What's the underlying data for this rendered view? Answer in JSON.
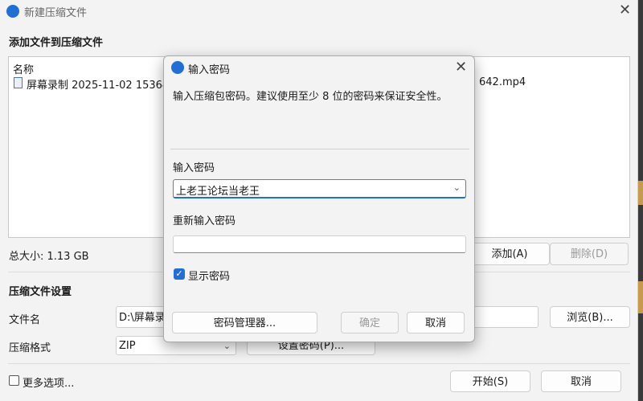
{
  "background": {
    "accent": "#c79b4e"
  },
  "window": {
    "title": "新建压缩文件",
    "section_add": "添加文件到压缩文件",
    "file_list": {
      "column_name": "名称",
      "items": [
        {
          "name_left": "屏幕录制 2025-11-02 153642",
          "name_right": "642.mp4"
        }
      ]
    },
    "total_size": "总大小: 1.13 GB",
    "add_button": "添加(A)",
    "delete_button": "删除(D)",
    "settings_title": "压缩文件设置",
    "filename_label": "文件名",
    "filename_value": "D:\\屏幕录",
    "browse_button": "浏览(B)...",
    "format_label": "压缩格式",
    "format_value": "ZIP",
    "set_password_button": "设置密码(P)...",
    "more_options": "更多选项...",
    "start_button": "开始(S)",
    "cancel_button": "取消"
  },
  "dialog": {
    "title": "输入密码",
    "description": "输入压缩包密码。建议使用至少 8 位的密码来保证安全性。",
    "password_label": "输入密码",
    "password_value": "上老王论坛当老王",
    "reenter_label": "重新输入密码",
    "reenter_value": "",
    "show_password_label": "显示密码",
    "show_password_checked": true,
    "manager_button": "密码管理器...",
    "ok_button": "确定",
    "cancel_button": "取消"
  },
  "colors": {
    "accent_blue": "#1f6fd6"
  }
}
